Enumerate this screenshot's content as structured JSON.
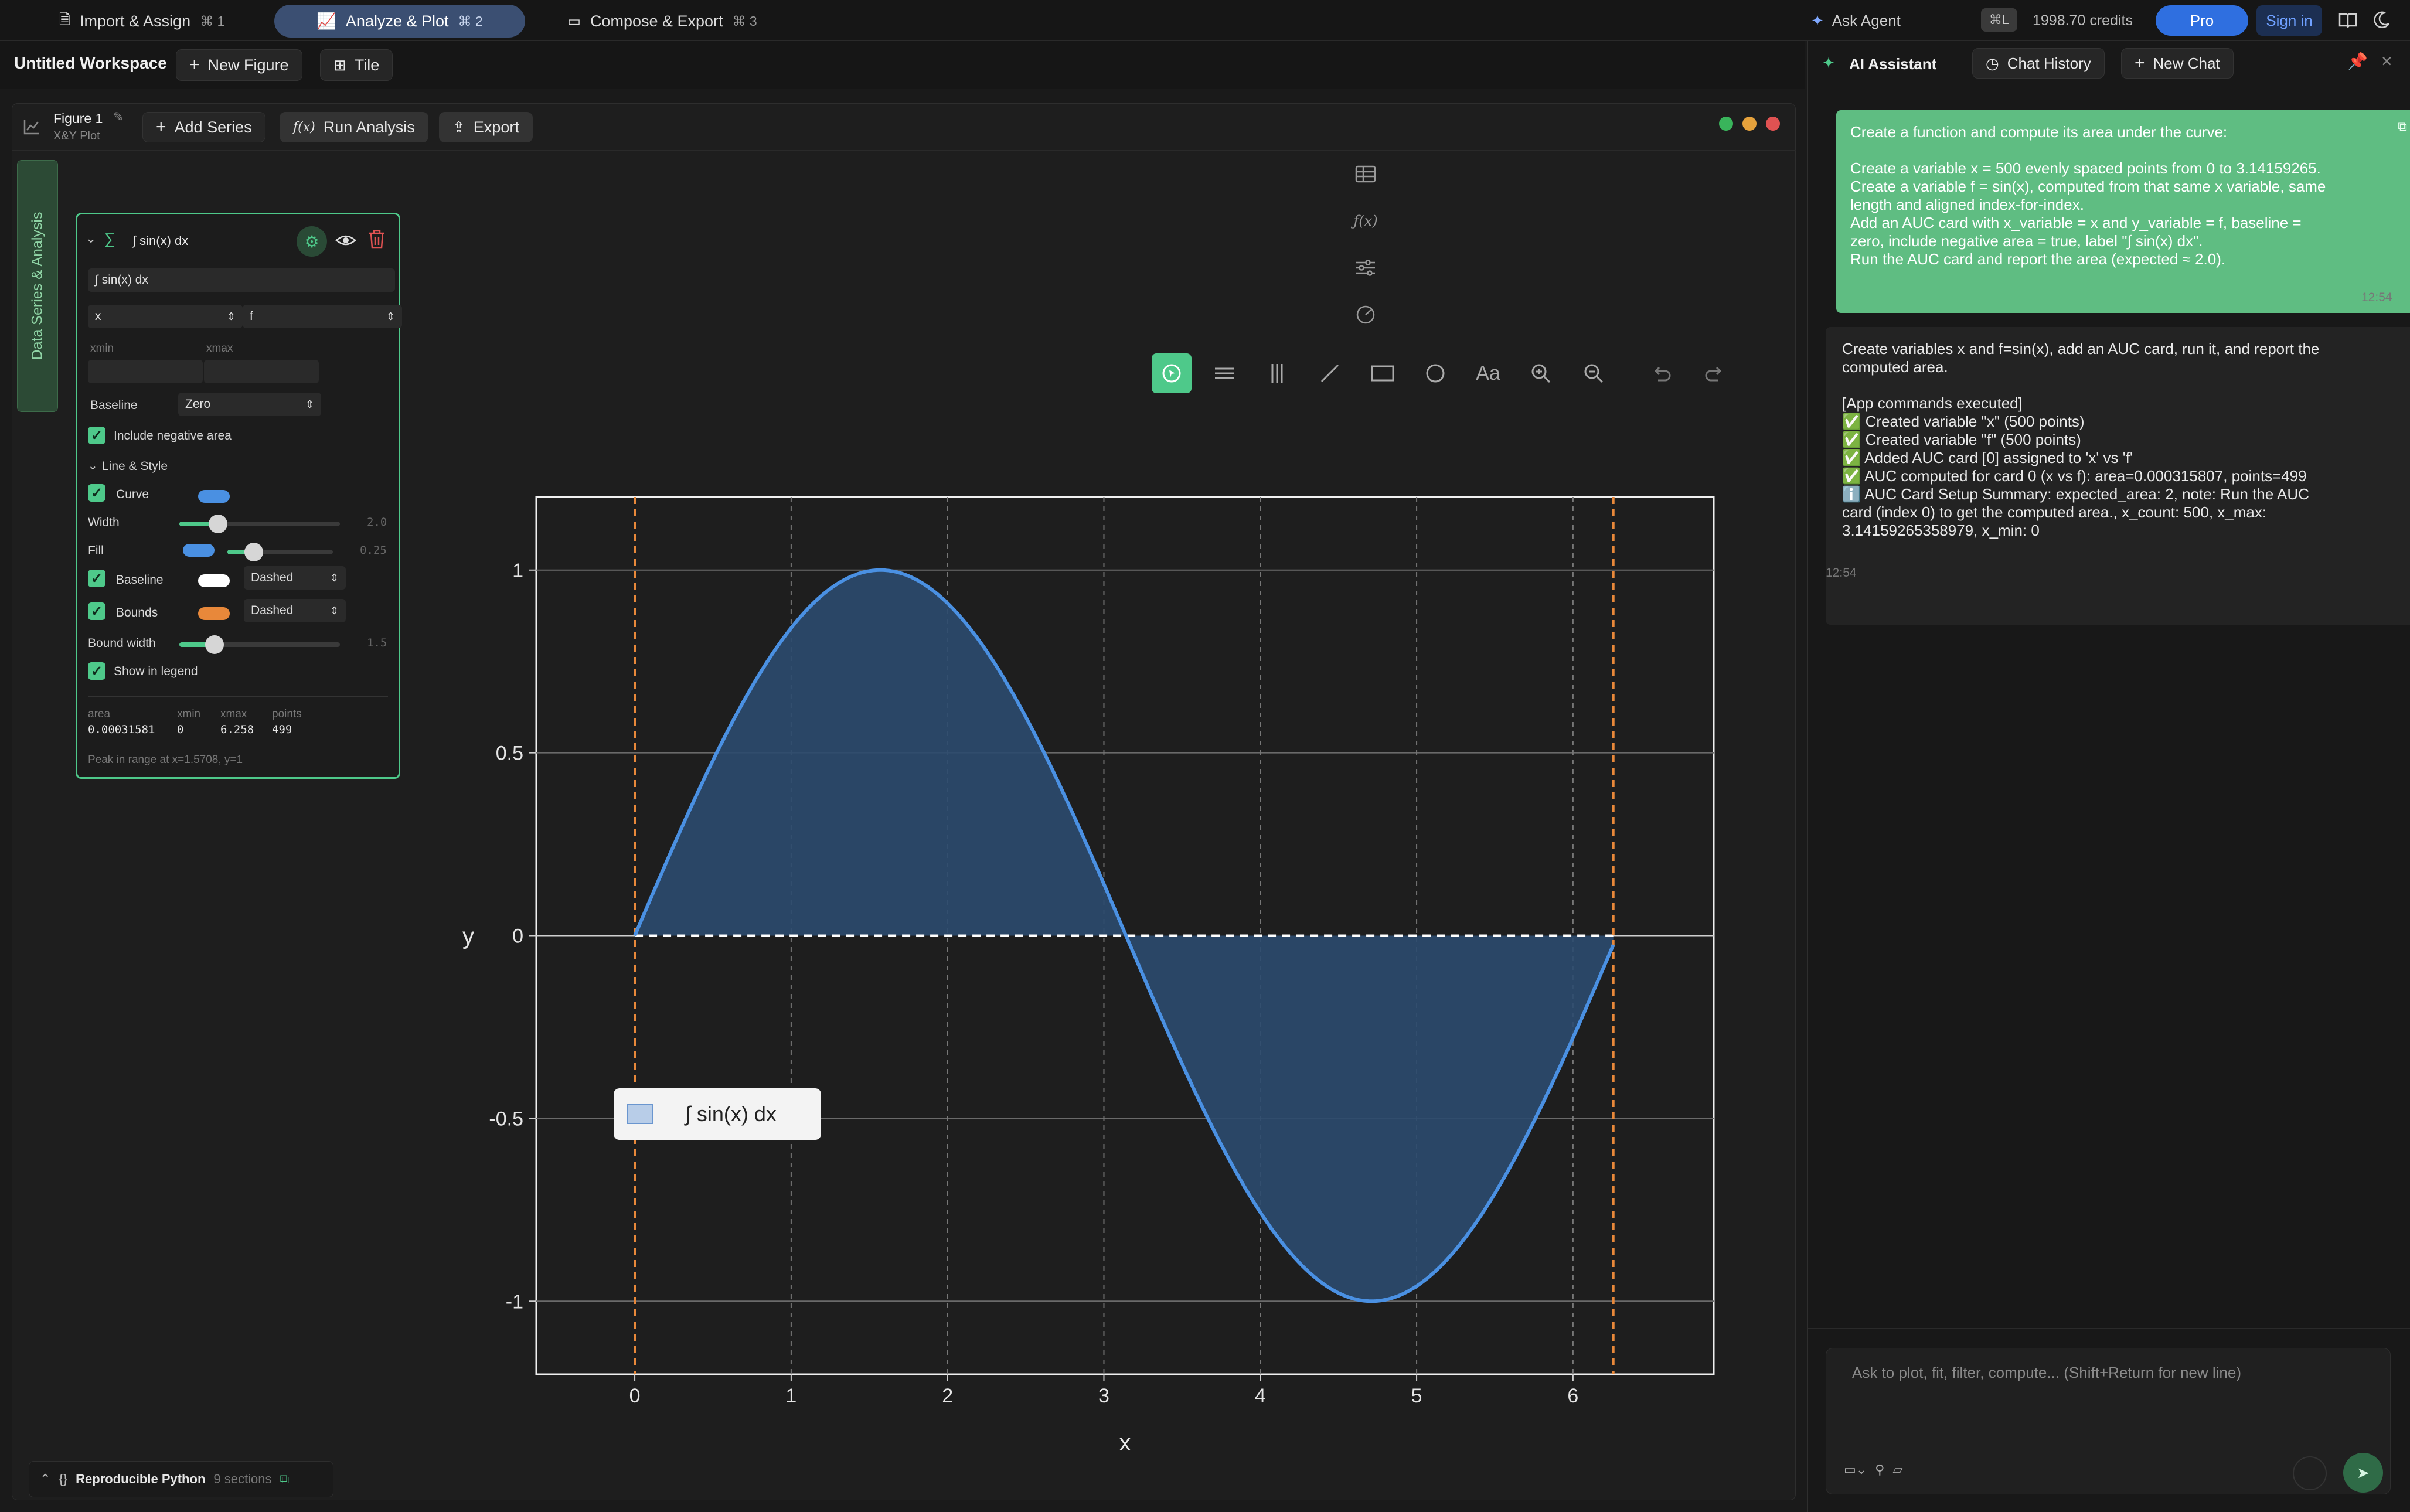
{
  "top_tabs": [
    {
      "label": "Import & Assign",
      "kbd": "⌘ 1",
      "icon": "document-icon"
    },
    {
      "label": "Analyze & Plot",
      "kbd": "⌘ 2",
      "icon": "chart-icon"
    },
    {
      "label": "Compose & Export",
      "kbd": "⌘ 3",
      "icon": "layout-icon"
    }
  ],
  "top_right": {
    "ask_agent": "Ask Agent",
    "shortcut": "⌘L",
    "credits": "1998.70 credits",
    "pro": "Pro",
    "sign_in": "Sign in"
  },
  "workspace": {
    "title": "Untitled Workspace",
    "new_figure": "New Figure",
    "tile": "Tile"
  },
  "figure": {
    "title": "Figure 1",
    "subtitle": "X&Y Plot",
    "add_series": "Add Series",
    "run_analysis": "Run Analysis",
    "run_analysis_icon": "f(x)",
    "export": "Export"
  },
  "sidebar_tab": "Data Series & Analysis",
  "series_card": {
    "name": "∫ sin(x) dx",
    "label_value": "∫ sin(x) dx",
    "x_var": "x",
    "y_var": "f",
    "xmin_label": "xmin",
    "xmax_label": "xmax",
    "baseline_label": "Baseline",
    "baseline_value": "Zero",
    "include_negative": "Include negative area",
    "line_style": "Line & Style",
    "curve": "Curve",
    "width": "Width",
    "width_val": "2.0",
    "width_level": 0.24,
    "fill": "Fill",
    "fill_val": "0.25",
    "fill_level": 0.25,
    "baseline_row": "Baseline",
    "baseline_style": "Dashed",
    "bounds": "Bounds",
    "bounds_style": "Dashed",
    "bound_width": "Bound width",
    "bound_width_val": "1.5",
    "bound_width_level": 0.22,
    "show_legend": "Show in legend",
    "stats": {
      "area_label": "area",
      "area": "0.00031581",
      "xmin_label": "xmin",
      "xmin": "0",
      "xmax_label": "xmax",
      "xmax": "6.258",
      "points_label": "points",
      "points": "499"
    },
    "peak": "Peak in range at x=1.5708, y=1"
  },
  "python_bar": {
    "label": "Reproducible Python",
    "sections": "9 sections"
  },
  "plot_toolbar_tools": [
    "pointer-icon",
    "hlines-icon",
    "vlines-icon",
    "line-icon",
    "rect-icon",
    "circle-icon",
    "text-icon",
    "zoom-in-icon",
    "zoom-out-icon",
    "undo-icon",
    "redo-icon"
  ],
  "plot_toolbar_text_tool": "Aa",
  "legend_label": "∫ sin(x) dx",
  "chart_data": {
    "type": "area",
    "series": [
      {
        "name": "∫ sin(x) dx",
        "function": "sin(x)",
        "x_range": [
          0,
          6.258
        ]
      }
    ],
    "xlabel": "x",
    "ylabel": "y",
    "xlim": [
      -0.63,
      6.9
    ],
    "ylim": [
      -1.2,
      1.2
    ],
    "xticks": [
      0,
      1,
      2,
      3,
      4,
      5,
      6
    ],
    "yticks": [
      1,
      0.5,
      0,
      -0.5,
      -1
    ],
    "ytick_labels": [
      "1",
      "0.5",
      "0",
      "-0.5",
      "-1"
    ],
    "baseline": 0,
    "bounds": [
      0,
      6.258
    ],
    "grid": true,
    "legend_position": "bottom-left",
    "colors": {
      "curve": "#4a90e2",
      "fill": "#2b4a6e",
      "baseline": "#ffffff",
      "bounds": "#e8883a",
      "grid": "#555555"
    }
  },
  "assistant": {
    "title": "AI Assistant",
    "chat_history": "Chat History",
    "new_chat": "New Chat",
    "user_message": [
      "Create a function and compute its area under the curve:",
      "",
      "Create a variable x = 500 evenly spaced points from 0 to 3.14159265.",
      "Create a variable f = sin(x), computed from that same x variable, same",
      "length and aligned index-for-index.",
      "Add an AUC card with x_variable = x and y_variable = f, baseline =",
      "zero, include negative area = true, label \"∫ sin(x) dx\".",
      "Run the AUC card and report the area (expected ≈ 2.0)."
    ],
    "user_time": "12:54",
    "ai_message": [
      "Create variables x and f=sin(x), add an AUC card, run it, and report the",
      "computed area.",
      "",
      "[App commands executed]",
      "✅ Created variable \"x\" (500 points)",
      "✅ Created variable \"f\" (500 points)",
      "✅ Added AUC card [0] assigned to 'x' vs 'f'",
      "✅ AUC computed for card 0 (x vs f): area=0.000315807, points=499",
      "ℹ️ AUC Card Setup Summary: expected_area: 2, note: Run the AUC",
      "card (index 0) to get the computed area., x_count: 500, x_max:",
      "3.14159265358979, x_min: 0"
    ],
    "ai_time": "12:54",
    "input_placeholder": "Ask to plot, fit, filter, compute... (Shift+Return for new line)"
  }
}
